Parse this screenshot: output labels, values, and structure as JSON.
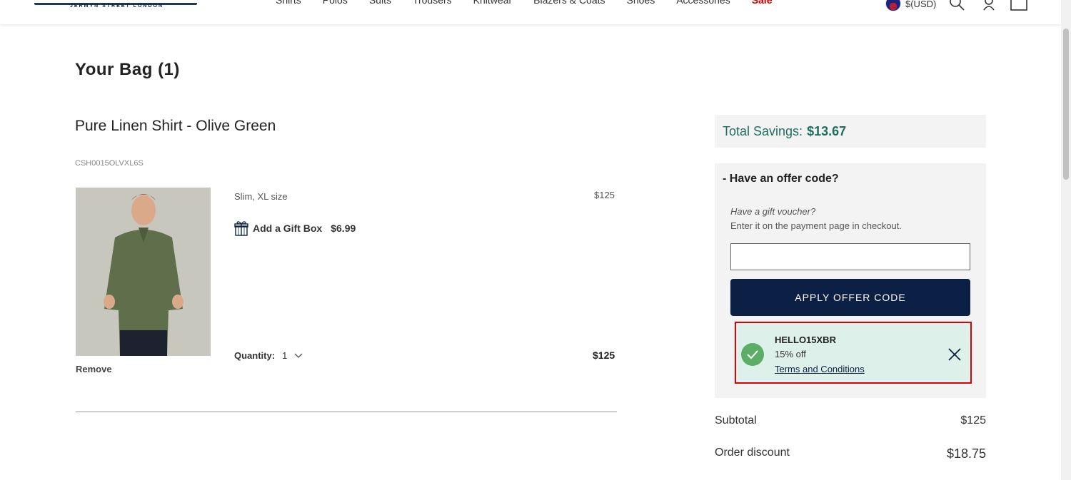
{
  "header": {
    "logo_sub": "JERMYN STREET LONDON",
    "nav": [
      "Shirts",
      "Polos",
      "Suits",
      "Trousers",
      "Knitwear",
      "Blazers & Coats",
      "Shoes",
      "Accessories",
      "Sale"
    ],
    "currency": "$(USD)",
    "icons": [
      "search-icon",
      "account-icon",
      "bag-icon"
    ]
  },
  "bag": {
    "title": "Your Bag (1)",
    "item": {
      "name": "Pure Linen Shirt - Olive Green",
      "sku": "CSH0015OLVXL6S",
      "fit_size": "Slim, XL size",
      "unit_price": "$125",
      "gift_box_label": "Add a Gift Box",
      "gift_box_price": "$6.99",
      "quantity_label": "Quantity:",
      "quantity": "1",
      "line_price": "$125",
      "remove_label": "Remove"
    }
  },
  "summary": {
    "savings_label": "Total Savings:",
    "savings_value": "$13.67",
    "offer_header": "-  Have an offer code?",
    "gift_voucher_q": "Have a gift voucher?",
    "gift_voucher_hint": "Enter it on the payment page in checkout.",
    "offer_input_value": "",
    "apply_label": "APPLY OFFER CODE",
    "applied_code": {
      "code": "HELLO15XBR",
      "description": "15% off",
      "terms": "Terms and Conditions"
    },
    "subtotal_label": "Subtotal",
    "subtotal_value": "$125",
    "discount_label": "Order discount",
    "discount_value": "$18.75"
  },
  "colors": {
    "navy": "#0c1f45",
    "savings_green": "#1e6e5e",
    "applied_bg": "#ddf0ea",
    "check_green": "#5cae67",
    "highlight_red": "#e00000",
    "sale_red": "#cc0000"
  }
}
